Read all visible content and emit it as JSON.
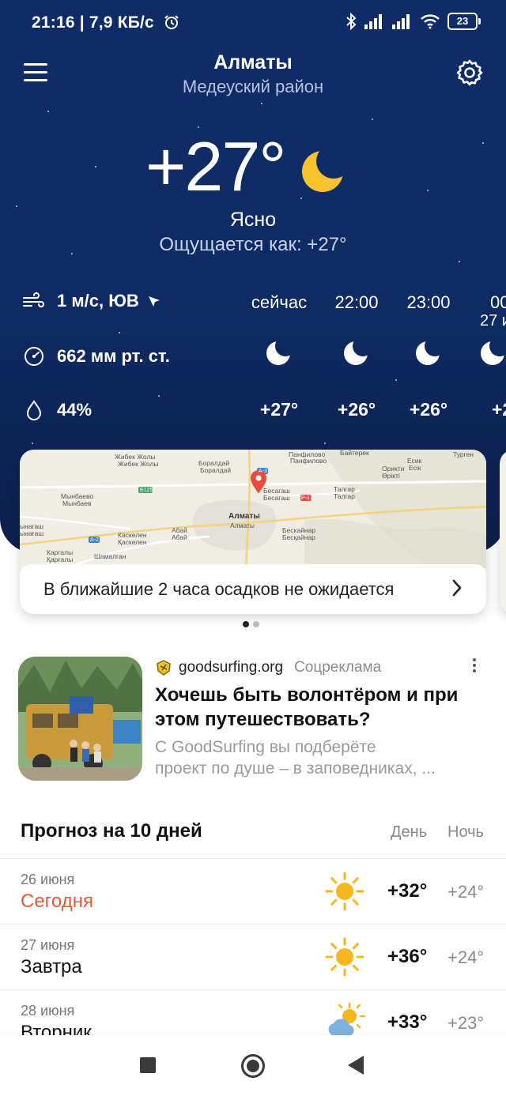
{
  "status_bar": {
    "time": "21:16",
    "speed": "7,9 КБ/с",
    "battery": "23"
  },
  "header": {
    "city": "Алматы",
    "district": "Медеуский район"
  },
  "current": {
    "temperature": "+27°",
    "condition": "Ясно",
    "feels_like": "Ощущается как: +27°",
    "wind": "1 м/с, ЮВ",
    "pressure": "662 мм рт. ст.",
    "humidity": "44%"
  },
  "hourly": [
    {
      "time": "сейчас",
      "date": "",
      "temp": "+27°",
      "icon": "moon-icon"
    },
    {
      "time": "22:00",
      "date": "",
      "temp": "+26°",
      "icon": "moon-icon"
    },
    {
      "time": "23:00",
      "date": "",
      "temp": "+26°",
      "icon": "moon-icon"
    },
    {
      "time": "00",
      "date": "27 и",
      "temp": "+2",
      "icon": "moon-icon"
    }
  ],
  "map": {
    "precipitation_text": "В ближайшие 2 часа осадков не ожидается",
    "labels": {
      "zhibek1": "Жибек Жолы",
      "zhibek2": "Жибек Жолы",
      "boraldai1": "Боралдай",
      "boraldai2": "Боралдай",
      "bayterek": "Байтерек",
      "panfilovo1": "Панфилово",
      "panfilovo2": "Панфилово",
      "turgen": "Турген",
      "esik1": "Есик",
      "esik2": "Есік",
      "orikti1": "Орикти",
      "orikti2": "Өрікті",
      "mynbaevo1": "Мынбаево",
      "mynbaevo2": "Мынбаев",
      "besagash1": "Бесагаш",
      "besagash2": "Бесагаш",
      "talgar1": "Талгар",
      "talgar2": "Талгар",
      "almaty1": "Алматы",
      "almaty2": "Алматы",
      "uzynagash1": "ынагаш",
      "uzynagash2": "ынағаш",
      "kaskelen1": "Каскелен",
      "kaskelen2": "Қаскелен",
      "abai1": "Абай",
      "abai2": "Абай",
      "beskainar1": "Бескайнар",
      "beskainar2": "Бесқайнар",
      "kargaly1": "Каргалы",
      "kargaly2": "Қарғалы",
      "shamalgan": "Шамалган",
      "road_e125": "E125",
      "road_a3": "A-3",
      "road_a2": "A-2",
      "road_p17": "P-17"
    }
  },
  "ad": {
    "domain": "goodsurfing.org",
    "label": "Соцреклама",
    "title": "Хочешь быть волонтёром и при этом путешествовать?",
    "description_line1": "С GoodSurfing вы подберёте",
    "description_line2": "проект по душе – в заповедниках, ..."
  },
  "forecast": {
    "title": "Прогноз на 10 дней",
    "day_label": "День",
    "night_label": "Ночь",
    "days": [
      {
        "date": "26 июня",
        "name": "Сегодня",
        "day": "+32°",
        "night": "+24°",
        "icon": "sun-icon"
      },
      {
        "date": "27 июня",
        "name": "Завтра",
        "day": "+36°",
        "night": "+24°",
        "icon": "sun-icon"
      },
      {
        "date": "28 июня",
        "name": "Вторник",
        "day": "+33°",
        "night": "+23°",
        "icon": "partly-cloudy-icon"
      }
    ]
  },
  "colors": {
    "hero_bg": "#0f2c67",
    "moon": "#f5c42c",
    "sun": "#f6b71d",
    "today": "#e05a3b",
    "pin": "#e84b3c"
  }
}
